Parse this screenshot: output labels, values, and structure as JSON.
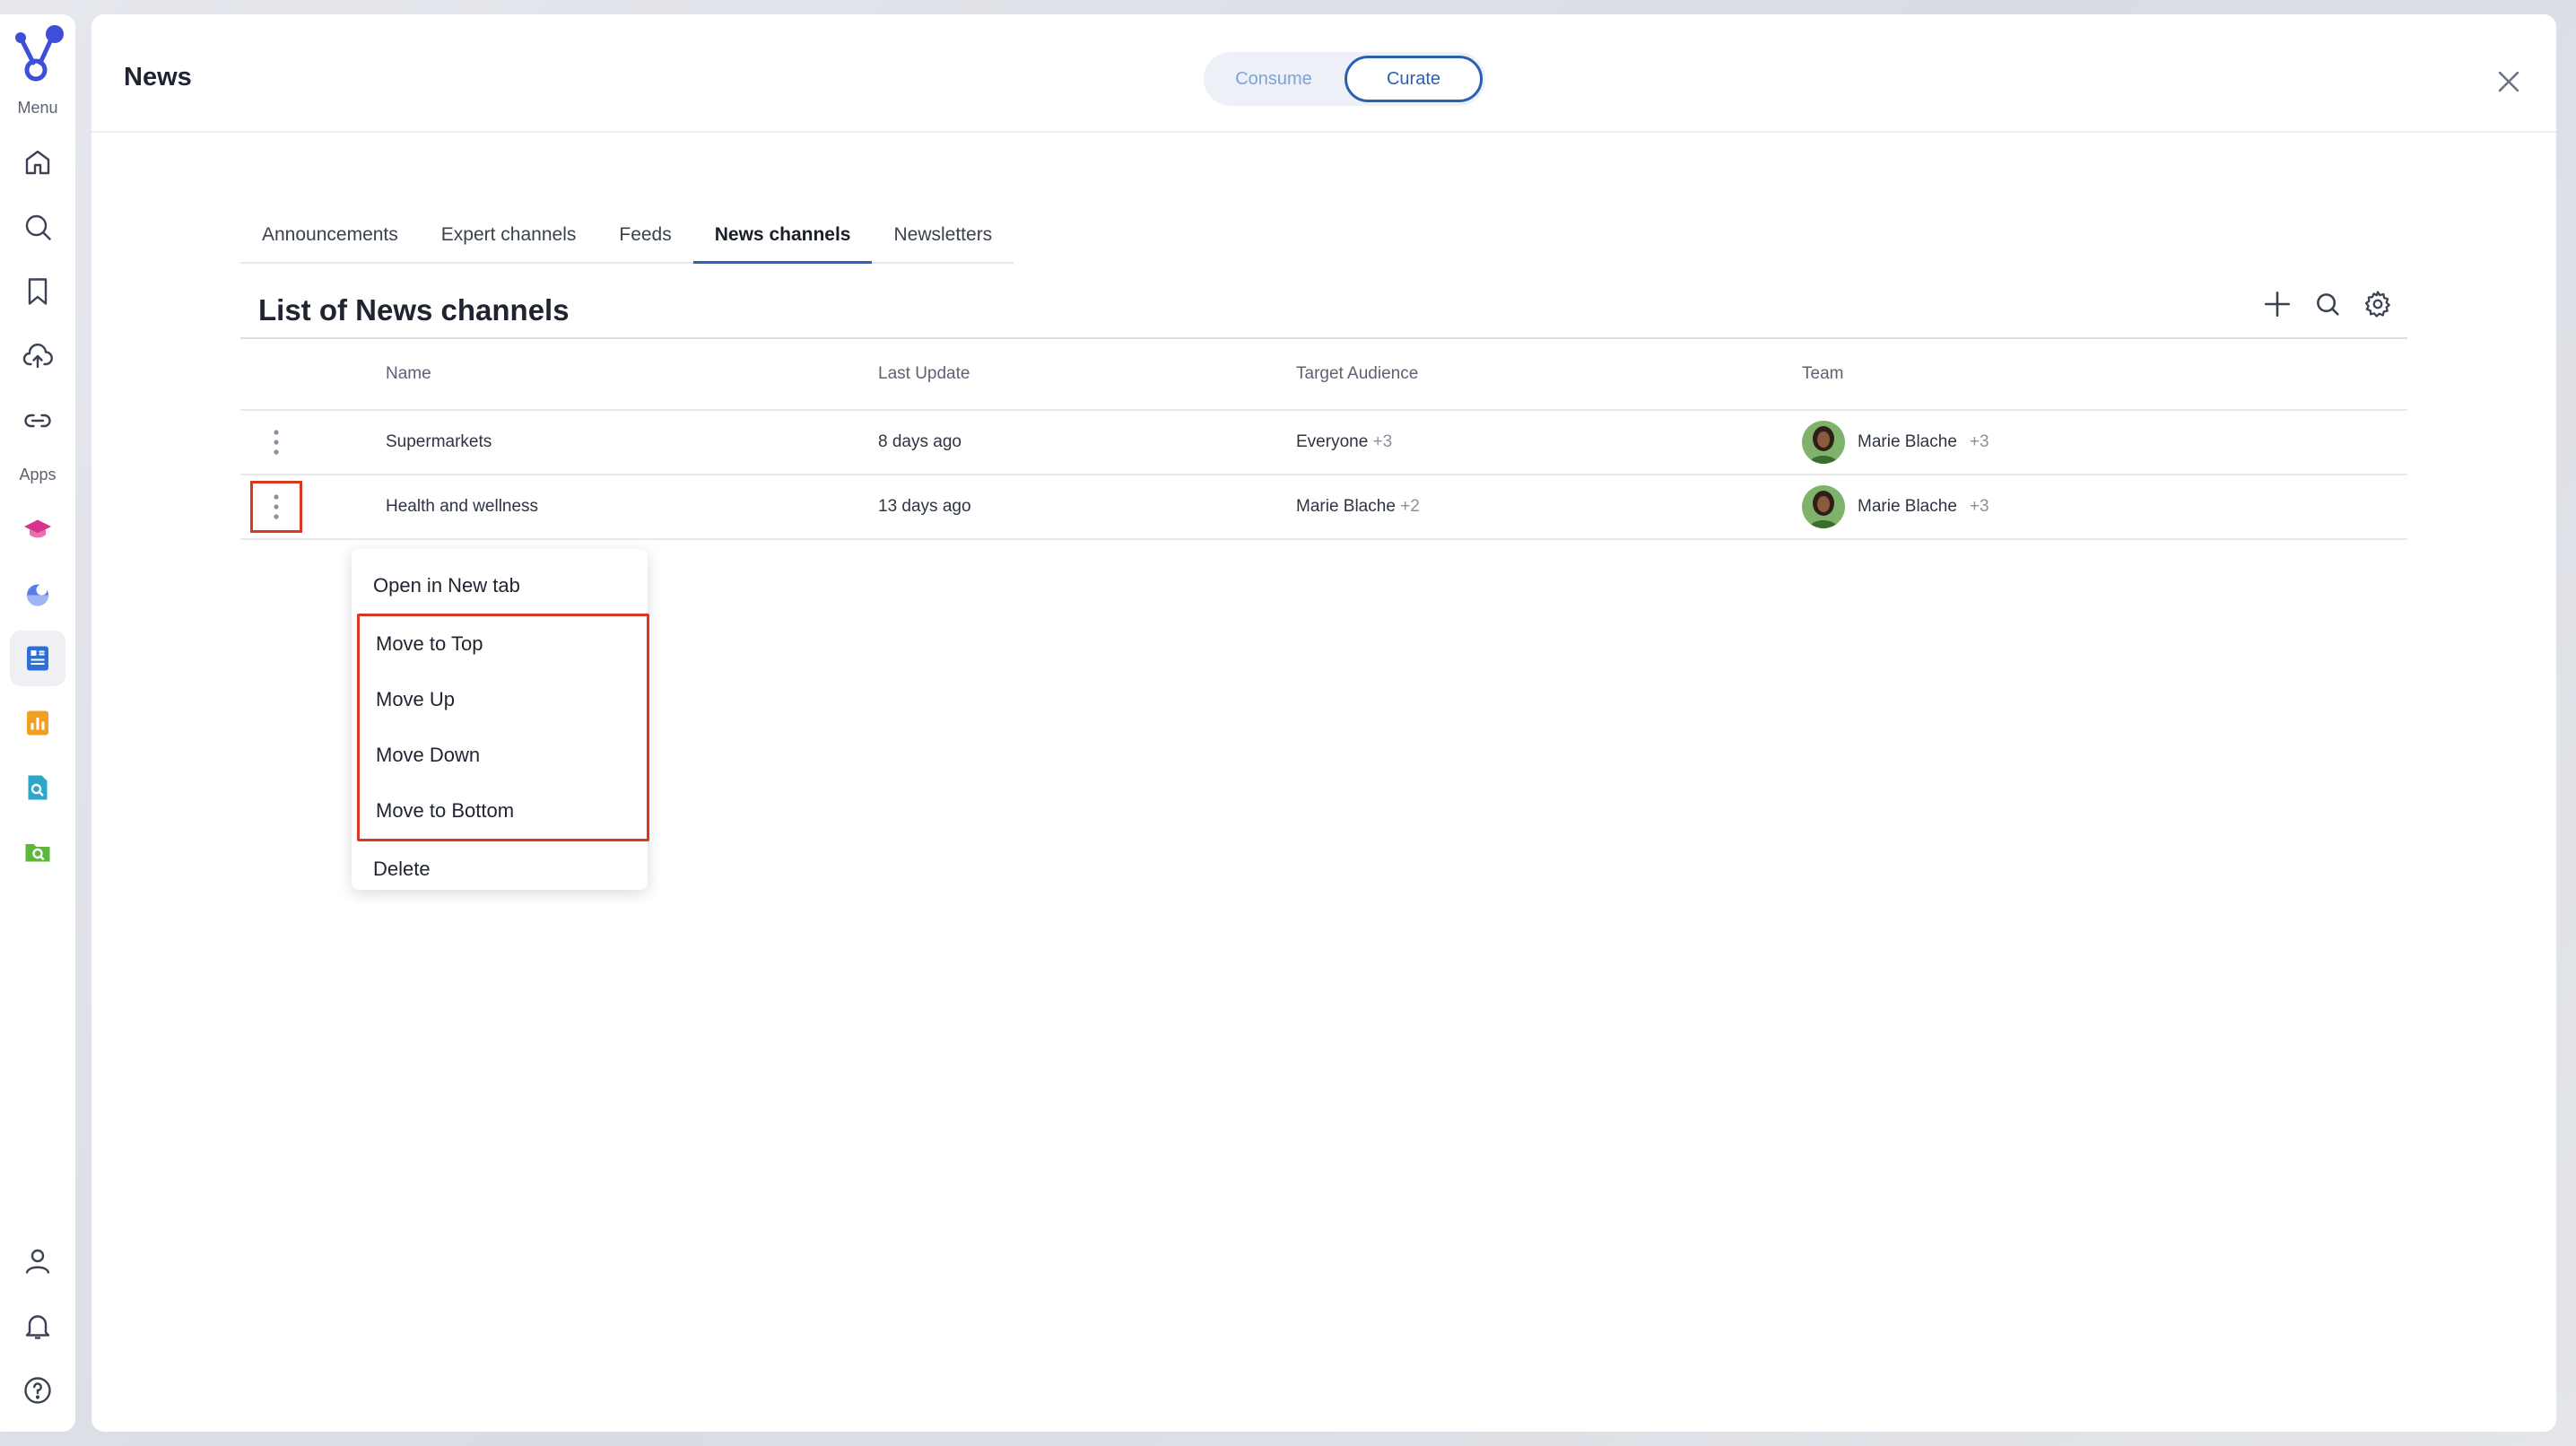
{
  "rail": {
    "menu_label": "Menu",
    "apps_label": "Apps"
  },
  "header": {
    "title": "News",
    "toggle": {
      "options": [
        "Consume",
        "Curate"
      ],
      "selected": "Curate"
    }
  },
  "tabs": [
    {
      "label": "Announcements"
    },
    {
      "label": "Expert channels"
    },
    {
      "label": "Feeds"
    },
    {
      "label": "News channels",
      "active": true
    },
    {
      "label": "Newsletters"
    }
  ],
  "list": {
    "title": "List of News channels",
    "columns": {
      "name": "Name",
      "last_update": "Last Update",
      "audience": "Target Audience",
      "team": "Team"
    },
    "rows": [
      {
        "name": "Supermarkets",
        "last_update": "8 days ago",
        "audience": "Everyone",
        "audience_more": "+3",
        "team": "Marie Blache",
        "team_more": "+3"
      },
      {
        "name": "Health and wellness",
        "last_update": "13 days ago",
        "audience": "Marie Blache",
        "audience_more": "+2",
        "team": "Marie Blache",
        "team_more": "+3"
      }
    ]
  },
  "context_menu": {
    "open_new_tab": "Open in New tab",
    "move_top": "Move to Top",
    "move_up": "Move Up",
    "move_down": "Move Down",
    "move_bottom": "Move to Bottom",
    "delete": "Delete"
  },
  "colors": {
    "accent": "#2b5fb0",
    "highlight": "#d9381e"
  }
}
